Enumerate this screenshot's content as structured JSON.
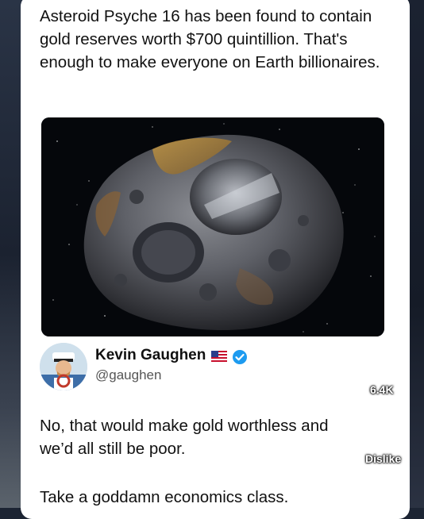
{
  "post": {
    "text": "Asteroid Psyche 16 has been found to contain gold reserves worth $700 quintillion. That's enough to make everyone on Earth billionaires.",
    "image_icon": "asteroid-image"
  },
  "reply": {
    "author_name": "Kevin Gaughen",
    "author_handle": "@gaughen",
    "flag_icon": "us-flag-icon",
    "verified_icon": "verified-badge-icon",
    "text_line1": "No, that would make gold worthless and we’d all still be poor.",
    "text_line2": "Take a goddamn economics class."
  },
  "actions": {
    "like_count": "6.4K",
    "dislike_label": "Dislike"
  },
  "colors": {
    "card_bg": "#ffffff",
    "verified_blue": "#1d9bf0",
    "overlay_text": "#ffffff"
  }
}
